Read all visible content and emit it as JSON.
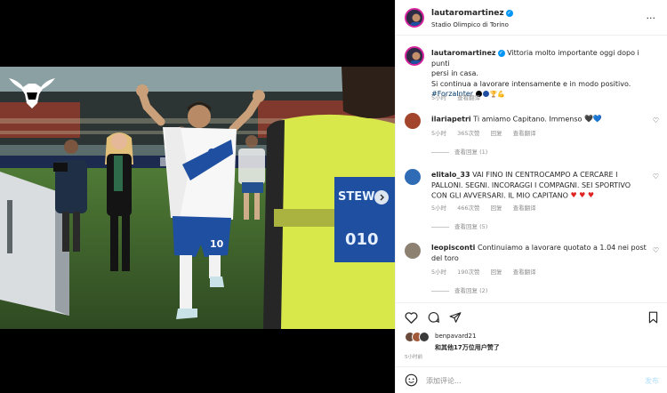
{
  "post": {
    "username": "lautaromartinez",
    "location": "Stadio Olimpico di Torino",
    "more_glyph": "···"
  },
  "caption": {
    "username": "lautaromartinez",
    "text_line1": "Vittoria molto importante oggi dopo i punti",
    "text_line2": "persi in casa.",
    "text_line3": "Si continua a lavorare intensamente e in modo positivo.",
    "hashtag": "#ForzaInter",
    "time": "5小时",
    "translate": "查看翻译"
  },
  "comments": [
    {
      "username": "ilariapetri",
      "text": "Ti amiamo Capitano. Immenso",
      "time": "5小时",
      "likes": "365次赞",
      "reply": "回复",
      "translate": "查看翻译",
      "replies": "查看回复 (1)"
    },
    {
      "username": "elitalo_33",
      "text": "VAI FINO IN CENTROCAMPO A CERCARE I PALLONI. SEGNI. INCORAGGI I COMPAGNI. SEI SPORTIVO CON GLI AVVERSARI. IL MIO CAPITANO",
      "time": "5小时",
      "likes": "466次赞",
      "reply": "回复",
      "translate": "查看翻译",
      "replies": "查看回复 (5)"
    },
    {
      "username": "leopisconti",
      "text": "Continuiamo a lavorare quotato a 1.04 nei post del toro",
      "time": "5小时",
      "likes": "190次赞",
      "reply": "回复",
      "translate": "查看翻译",
      "replies": "查看回复 (2)"
    }
  ],
  "likes": {
    "user": "benpavard21",
    "others": "和其他17万位用户赞了"
  },
  "time_ago": "5小时前",
  "add_comment": {
    "placeholder": "添加评论...",
    "post_label": "发布"
  },
  "colors": {
    "accent": "#0095f6",
    "link": "#00376b",
    "muted": "#8e8e8e",
    "inter_blue": "#1f4fa0"
  },
  "icons": [
    "ellipsis-icon",
    "verified-icon",
    "heart-icon",
    "comment-icon",
    "share-icon",
    "bookmark-icon",
    "emoji-icon",
    "chevron-right-icon"
  ]
}
